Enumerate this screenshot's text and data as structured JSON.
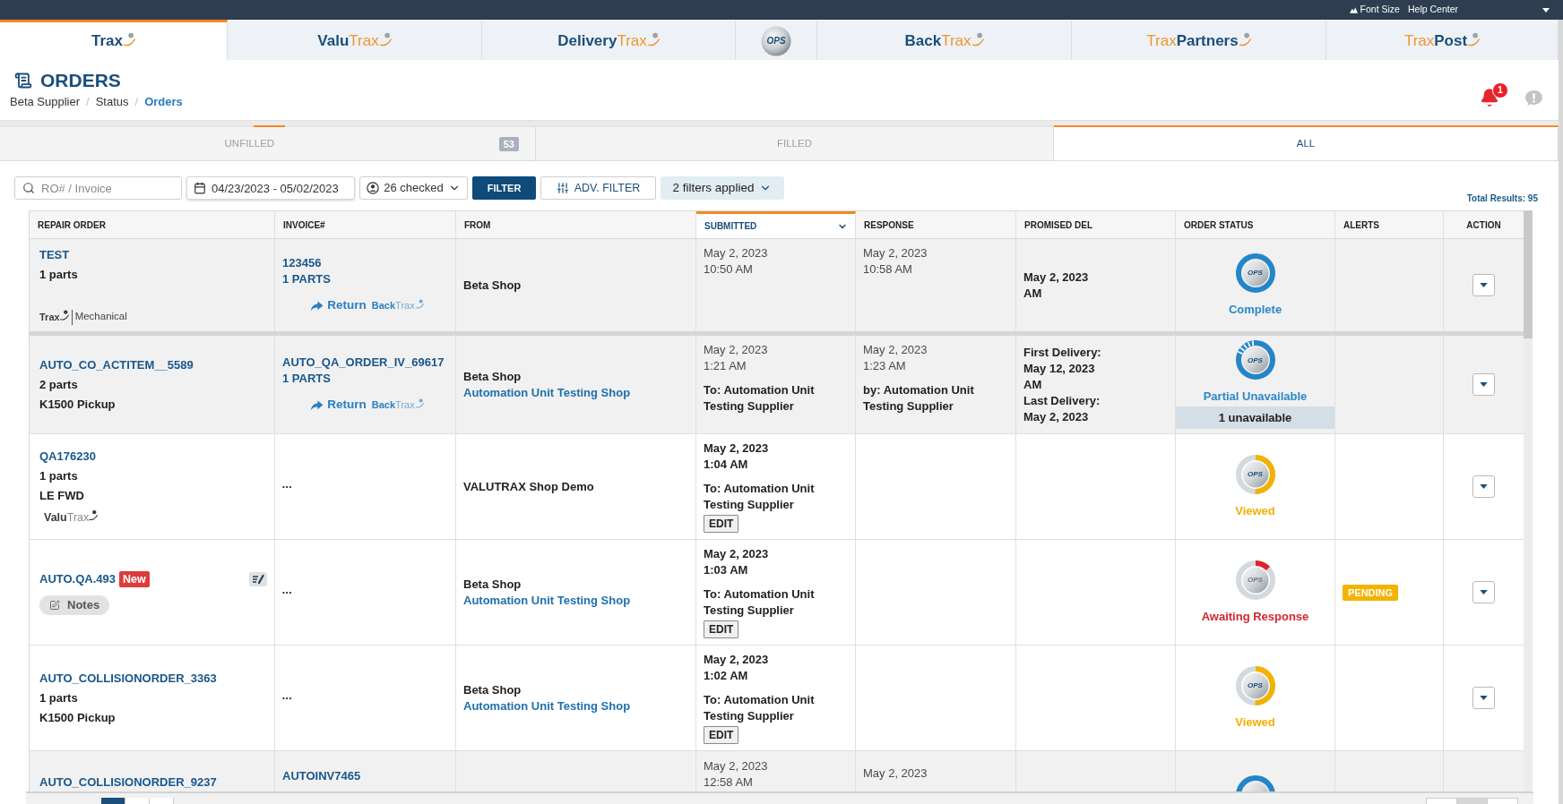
{
  "top_bar": {
    "links": [
      {
        "kind": "font_size",
        "label": "Font Size"
      },
      {
        "kind": "plain",
        "label": "Help Center"
      }
    ],
    "menu_caret": true
  },
  "product_tabs": [
    {
      "kind": "wordmark",
      "selected": true,
      "parts": [
        {
          "text": "Trax",
          "kind": "dark"
        }
      ]
    },
    {
      "kind": "wordmark",
      "selected": false,
      "parts": [
        {
          "text": "Valu",
          "kind": "dark"
        },
        {
          "text": "Trax",
          "kind": "orange"
        }
      ]
    },
    {
      "kind": "wordmark",
      "selected": false,
      "parts": [
        {
          "text": "Delivery",
          "kind": "dark"
        },
        {
          "text": "Trax",
          "kind": "orange"
        }
      ]
    },
    {
      "kind": "emblem",
      "selected": false,
      "text": "OPS"
    },
    {
      "kind": "wordmark",
      "selected": false,
      "parts": [
        {
          "text": "Back",
          "kind": "dark"
        },
        {
          "text": "Trax",
          "kind": "orange"
        }
      ]
    },
    {
      "kind": "wordmark",
      "selected": false,
      "parts": [
        {
          "text": "Trax",
          "kind": "orange"
        },
        {
          "text": "Partners",
          "kind": "dark"
        }
      ]
    },
    {
      "kind": "wordmark",
      "selected": false,
      "parts": [
        {
          "text": "Trax",
          "kind": "orange"
        },
        {
          "text": "Post",
          "kind": "dark"
        }
      ]
    }
  ],
  "page_header": {
    "title": "ORDERS",
    "breadcrumb": [
      {
        "label": "Beta Supplier",
        "current": false,
        "separator": "/"
      },
      {
        "label": "Status",
        "current": false,
        "separator": "/"
      },
      {
        "label": "Orders",
        "current": true
      }
    ],
    "notification_count": "1"
  },
  "status_tabs": [
    {
      "label": "UNFILLED",
      "selected": false,
      "count": "53"
    },
    {
      "label": "FILLED",
      "selected": false
    },
    {
      "label": "ALL",
      "selected": true
    }
  ],
  "filters": {
    "search": {
      "placeholder": "RO# / Invoice"
    },
    "date_range": {
      "value": "04/23/2023 - 05/02/2023"
    },
    "buttons": [
      {
        "kind": "checked",
        "label": "26 checked"
      },
      {
        "kind": "primary",
        "label": "FILTER"
      },
      {
        "kind": "advanced",
        "label": "ADV. FILTER"
      },
      {
        "kind": "applied",
        "label": "2 filters applied"
      }
    ],
    "total_results": "Total Results: 95"
  },
  "table": {
    "columns": [
      {
        "label": "REPAIR ORDER",
        "sorted": false
      },
      {
        "label": "INVOICE#",
        "sorted": false
      },
      {
        "label": "FROM",
        "sorted": false
      },
      {
        "label": "SUBMITTED",
        "sorted": true
      },
      {
        "label": "RESPONSE",
        "sorted": false
      },
      {
        "label": "PROMISED DEL",
        "sorted": false
      },
      {
        "label": "ORDER STATUS",
        "sorted": false
      },
      {
        "label": "ALERTS",
        "sorted": false
      },
      {
        "label": "ACTION",
        "sorted": false
      }
    ],
    "rows": [
      {
        "shaded": true,
        "repair_order": {
          "number": "TEST",
          "details": [
            "1 parts"
          ],
          "logo": {
            "kind": "mechanical",
            "parts": [
              {
                "text": "Trax",
                "kind": "strong"
              }
            ],
            "subtitle": "Mechanical"
          }
        },
        "invoice": {
          "lines": [
            "123456",
            "1 PARTS"
          ],
          "return_link": {
            "label": "Return",
            "parts": [
              {
                "text": "Back",
                "kind": "strong"
              },
              {
                "text": "Trax",
                "kind": "light"
              }
            ]
          }
        },
        "from": {
          "shop": "Beta Shop"
        },
        "submitted": {
          "date": "May 2, 2023",
          "time": "10:50 AM",
          "bold": false
        },
        "response": {
          "date": "May 2, 2023",
          "time": "10:58 AM"
        },
        "promised": [
          "May 2, 2023",
          "AM"
        ],
        "status": {
          "kind": "complete",
          "emblem": "OPS",
          "label": "Complete"
        },
        "action_menu": true
      },
      {
        "shaded": true,
        "repair_order": {
          "number": "AUTO_CO_ACTITEM__5589",
          "details": [
            "2 parts",
            "K1500 Pickup"
          ]
        },
        "invoice": {
          "lines": [
            "AUTO_QA_ORDER_IV_69617",
            "1 PARTS"
          ],
          "return_link": {
            "label": "Return",
            "parts": [
              {
                "text": "Back",
                "kind": "strong"
              },
              {
                "text": "Trax",
                "kind": "light"
              }
            ]
          }
        },
        "from": {
          "shop": "Beta Shop",
          "link": "Automation Unit Testing Shop"
        },
        "submitted": {
          "date": "May 2, 2023",
          "time": "1:21 AM",
          "bold": false,
          "to": "To: Automation Unit Testing Supplier"
        },
        "response": {
          "date": "May 2, 2023",
          "time": "1:23 AM",
          "by": "by: Automation Unit Testing Supplier"
        },
        "promised": [
          "First Delivery:",
          "May 12, 2023",
          "AM",
          "Last Delivery:",
          "May 2, 2023"
        ],
        "status": {
          "kind": "partial",
          "emblem": "OPS",
          "label": "Partial Unavailable",
          "note": "1 unavailable"
        },
        "action_menu": true
      },
      {
        "shaded": false,
        "repair_order": {
          "number": "QA176230",
          "details": [
            "1 parts",
            "LE FWD"
          ],
          "logo": {
            "kind": "wordmark",
            "parts": [
              {
                "text": "Valu",
                "kind": "strong"
              },
              {
                "text": "Trax",
                "kind": "light"
              }
            ]
          }
        },
        "invoice": {
          "ellipsis": "•••"
        },
        "from": {
          "shop": "VALUTRAX Shop Demo"
        },
        "submitted": {
          "date": "May 2, 2023",
          "time": "1:04 AM",
          "bold": true,
          "to": "To: Automation Unit Testing Supplier",
          "edit_button": "EDIT"
        },
        "status": {
          "kind": "viewed",
          "emblem": "OPS",
          "label": "Viewed"
        },
        "action_menu": true
      },
      {
        "shaded": false,
        "repair_order": {
          "number": "AUTO.QA.493",
          "new_badge": "New",
          "note_icon": true,
          "notes_button": "Notes"
        },
        "invoice": {
          "ellipsis": "•••"
        },
        "from": {
          "shop": "Beta Shop",
          "link": "Automation Unit Testing Shop"
        },
        "submitted": {
          "date": "May 2, 2023",
          "time": "1:03 AM",
          "bold": true,
          "to": "To: Automation Unit Testing Supplier",
          "edit_button": "EDIT"
        },
        "status": {
          "kind": "awaiting",
          "emblem": "OPS",
          "label": "Awaiting Response"
        },
        "alert": {
          "label": "PENDING"
        },
        "action_menu": true
      },
      {
        "shaded": false,
        "repair_order": {
          "number": "AUTO_COLLISIONORDER_3363",
          "details": [
            "1 parts",
            "K1500 Pickup"
          ]
        },
        "invoice": {
          "ellipsis": "•••"
        },
        "from": {
          "shop": "Beta Shop",
          "link": "Automation Unit Testing Shop"
        },
        "submitted": {
          "date": "May 2, 2023",
          "time": "1:02 AM",
          "bold": true,
          "to": "To: Automation Unit Testing Supplier",
          "edit_button": "EDIT"
        },
        "status": {
          "kind": "viewed",
          "emblem": "OPS",
          "label": "Viewed"
        },
        "action_menu": true
      },
      {
        "shaded": true,
        "cut": true,
        "repair_order": {
          "number": "AUTO_COLLISIONORDER_9237"
        },
        "invoice": {
          "lines": [
            "AUTOINV7465"
          ]
        },
        "submitted": {
          "date": "May 2, 2023",
          "time": "12:58 AM",
          "bold": false
        },
        "response": {
          "date": "May 2, 2023"
        },
        "status": {
          "kind": "complete"
        }
      }
    ]
  },
  "pagination": {
    "left_buttons": [
      {
        "selected": true
      },
      {
        "selected": false
      },
      {
        "selected": false
      }
    ],
    "right_buttons": [
      {
        "selected": false
      },
      {
        "selected": true
      },
      {
        "selected": false
      }
    ]
  }
}
